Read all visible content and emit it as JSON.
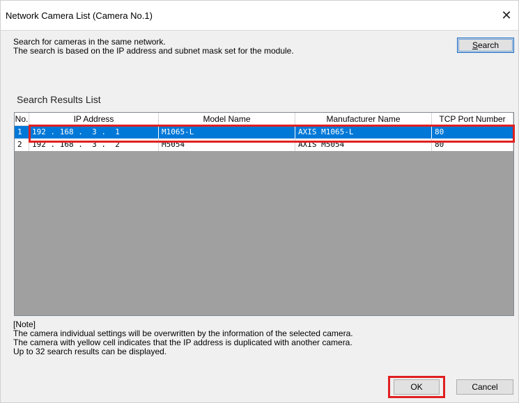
{
  "window": {
    "title": "Network Camera List (Camera No.1)",
    "close_glyph": "✕"
  },
  "description": {
    "line1": "Search for cameras in the same network.",
    "line2": "The search is based on the IP address and subnet mask set for the module."
  },
  "search_button": {
    "mnemonic": "S",
    "rest": "earch"
  },
  "results": {
    "label": "Search Results List",
    "columns": [
      "No.",
      "IP Address",
      "Model Name",
      "Manufacturer Name",
      "TCP Port Number"
    ],
    "rows": [
      {
        "no": "1",
        "ip": "192 . 168 .  3 .  1",
        "model": "M1065-L",
        "manufacturer": "AXIS M1065-L",
        "port": "80",
        "selected": true
      },
      {
        "no": "2",
        "ip": "192 . 168 .  3 .  2",
        "model": "M5054",
        "manufacturer": "AXIS M5054",
        "port": "80",
        "selected": false
      }
    ]
  },
  "note": {
    "heading": "[Note]",
    "line1": "The camera individual settings will be overwritten by the information of the selected camera.",
    "line2": "The camera with yellow cell indicates that the IP address is duplicated with another camera.",
    "line3": "Up to 32 search results can be displayed."
  },
  "buttons": {
    "ok": "OK",
    "cancel": "Cancel"
  },
  "colors": {
    "selection": "#0078d7",
    "highlight_box": "#e02020",
    "list_empty_area": "#a0a0a0"
  }
}
